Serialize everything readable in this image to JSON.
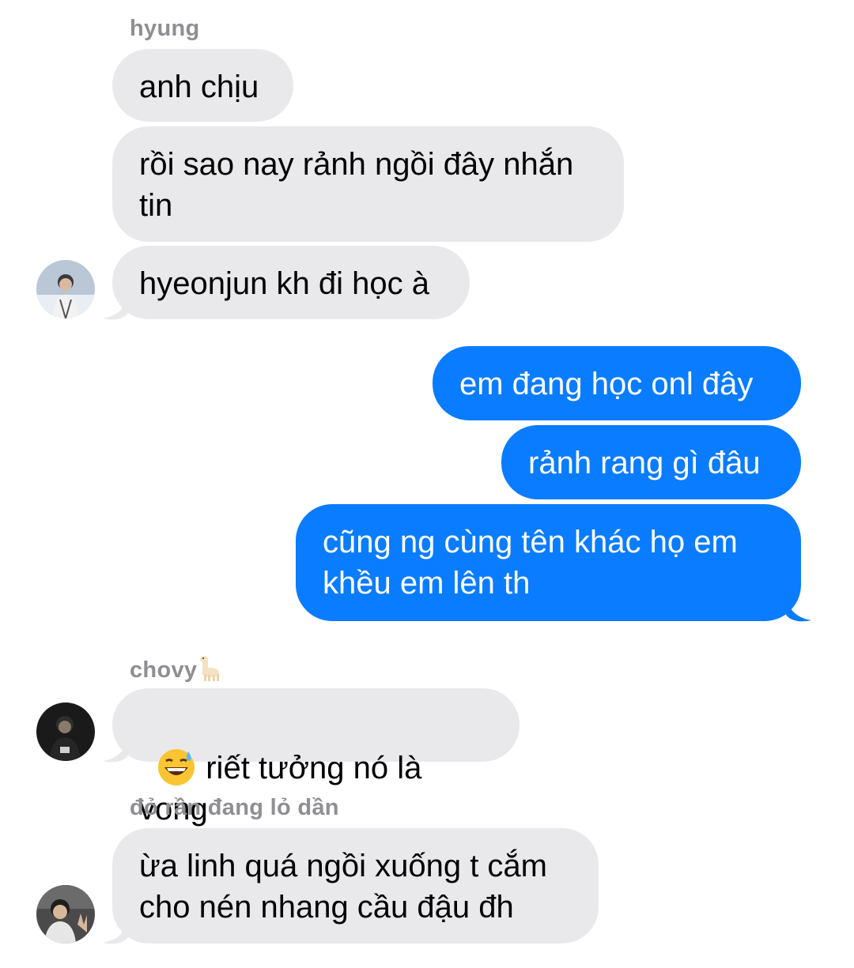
{
  "conversation": {
    "groups": [
      {
        "sender": "hyung",
        "avatar_icon": "person-photo-avatar",
        "messages": [
          "anh chịu",
          "rồi sao nay rảnh ngồi đây nhắn\ntin",
          "hyeonjun kh đi học à"
        ]
      },
      {
        "sender": "",
        "outgoing": true,
        "messages": [
          "em đang học onl đây",
          "rảnh rang gì đâu",
          "cũng ng cùng tên khác họ em\nkhều em lên th"
        ]
      },
      {
        "sender": "chovy",
        "sender_emoji_icon": "llama-emoji",
        "avatar_icon": "person-photo-avatar",
        "messages": [
          {
            "emoji_icon": "grinning-face-with-sweat-emoji",
            "text": "riết tưởng nó là vong"
          }
        ]
      },
      {
        "sender": "đỏ rần đang lỏ dần",
        "avatar_icon": "person-photo-avatar",
        "messages": [
          "ừa linh quá ngồi xuống t cắm\ncho nén nhang cầu đậu đh"
        ]
      }
    ]
  },
  "colors": {
    "incoming_bubble": "#e9e9eb",
    "outgoing_bubble": "#0a7cff",
    "sender_name": "#8e8e93"
  }
}
